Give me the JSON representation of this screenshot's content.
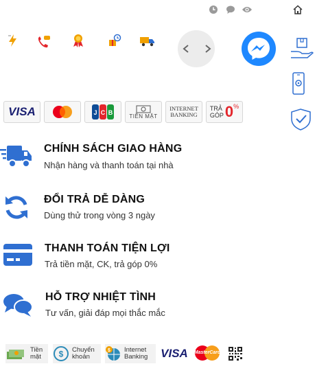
{
  "colors": {
    "brand_blue": "#2f6fd1",
    "messenger": "#1e88ff",
    "red": "#e3262c",
    "orange": "#f0a000"
  },
  "top_icons": [
    "clock-icon",
    "comment-icon",
    "eye-icon",
    "home-icon"
  ],
  "feature_icons": [
    "flash-icon",
    "phone-call-icon",
    "award-ribbon-icon",
    "gift-timer-icon",
    "delivery-truck-icon"
  ],
  "rail_icons": [
    "box-in-hand-icon",
    "phone-settings-icon",
    "shield-check-icon"
  ],
  "payments": {
    "visa": "VISA",
    "cash": "TIỀN MẶT",
    "internet_banking_1": "INTERNET",
    "internet_banking_2": "BANKING",
    "installment_1": "TRẢ",
    "installment_2": "GÓP",
    "installment_value": "0",
    "installment_percent": "%"
  },
  "benefits": [
    {
      "title": "CHÍNH SÁCH GIAO HÀNG",
      "subtitle": "Nhận hàng và thanh toán tại nhà",
      "icon": "delivery-truck-icon"
    },
    {
      "title": "ĐỔI TRẢ DỄ DÀNG",
      "subtitle": "Dùng thử trong vòng 3 ngày",
      "icon": "refresh-icon"
    },
    {
      "title": "THANH TOÁN TIỆN LỢI",
      "subtitle": "Trả tiền mặt, CK, trả góp 0%",
      "icon": "credit-card-icon"
    },
    {
      "title": "HỖ TRỢ NHIỆT TÌNH",
      "subtitle": "Tư vấn, giải đáp mọi thắc mắc",
      "icon": "chat-bubbles-icon"
    }
  ],
  "bottom": {
    "cash_1": "Tiền",
    "cash_2": "mặt",
    "transfer_1": "Chuyển",
    "transfer_2": "khoản",
    "ib_1": "Internet",
    "ib_2": "Banking",
    "visa": "VISA",
    "mastercard": "MasterCard"
  }
}
